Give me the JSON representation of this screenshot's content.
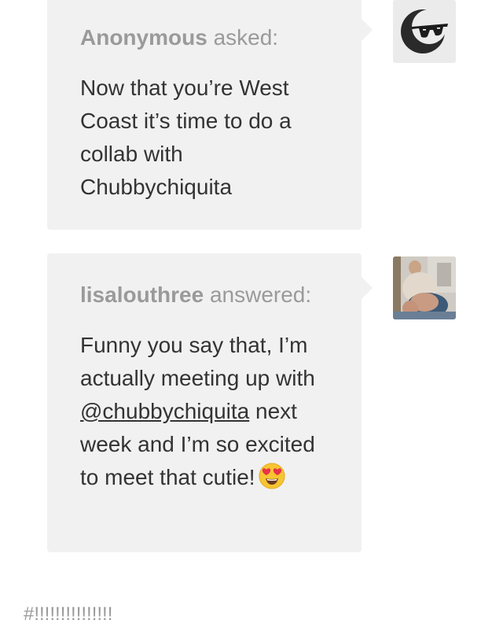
{
  "ask": {
    "asker": "Anonymous",
    "verb": "asked:",
    "question": "Now that you’re West Coast it’s time to do a collab with Chubbychiquita",
    "avatar_icon": "sunglasses-avatar-icon"
  },
  "answer": {
    "answerer": "lisalouthree",
    "verb": "answered:",
    "text_before_mention": "Funny you say that, I’m actually meeting up with ",
    "mention": "@chubbychiquita",
    "text_after_mention": " next week and I’m so excited to meet that cutie!",
    "emoji": "heart-eyes-emoji",
    "avatar_icon": "profile-photo-avatar"
  },
  "tags": "#!!!!!!!!!!!!!!!"
}
